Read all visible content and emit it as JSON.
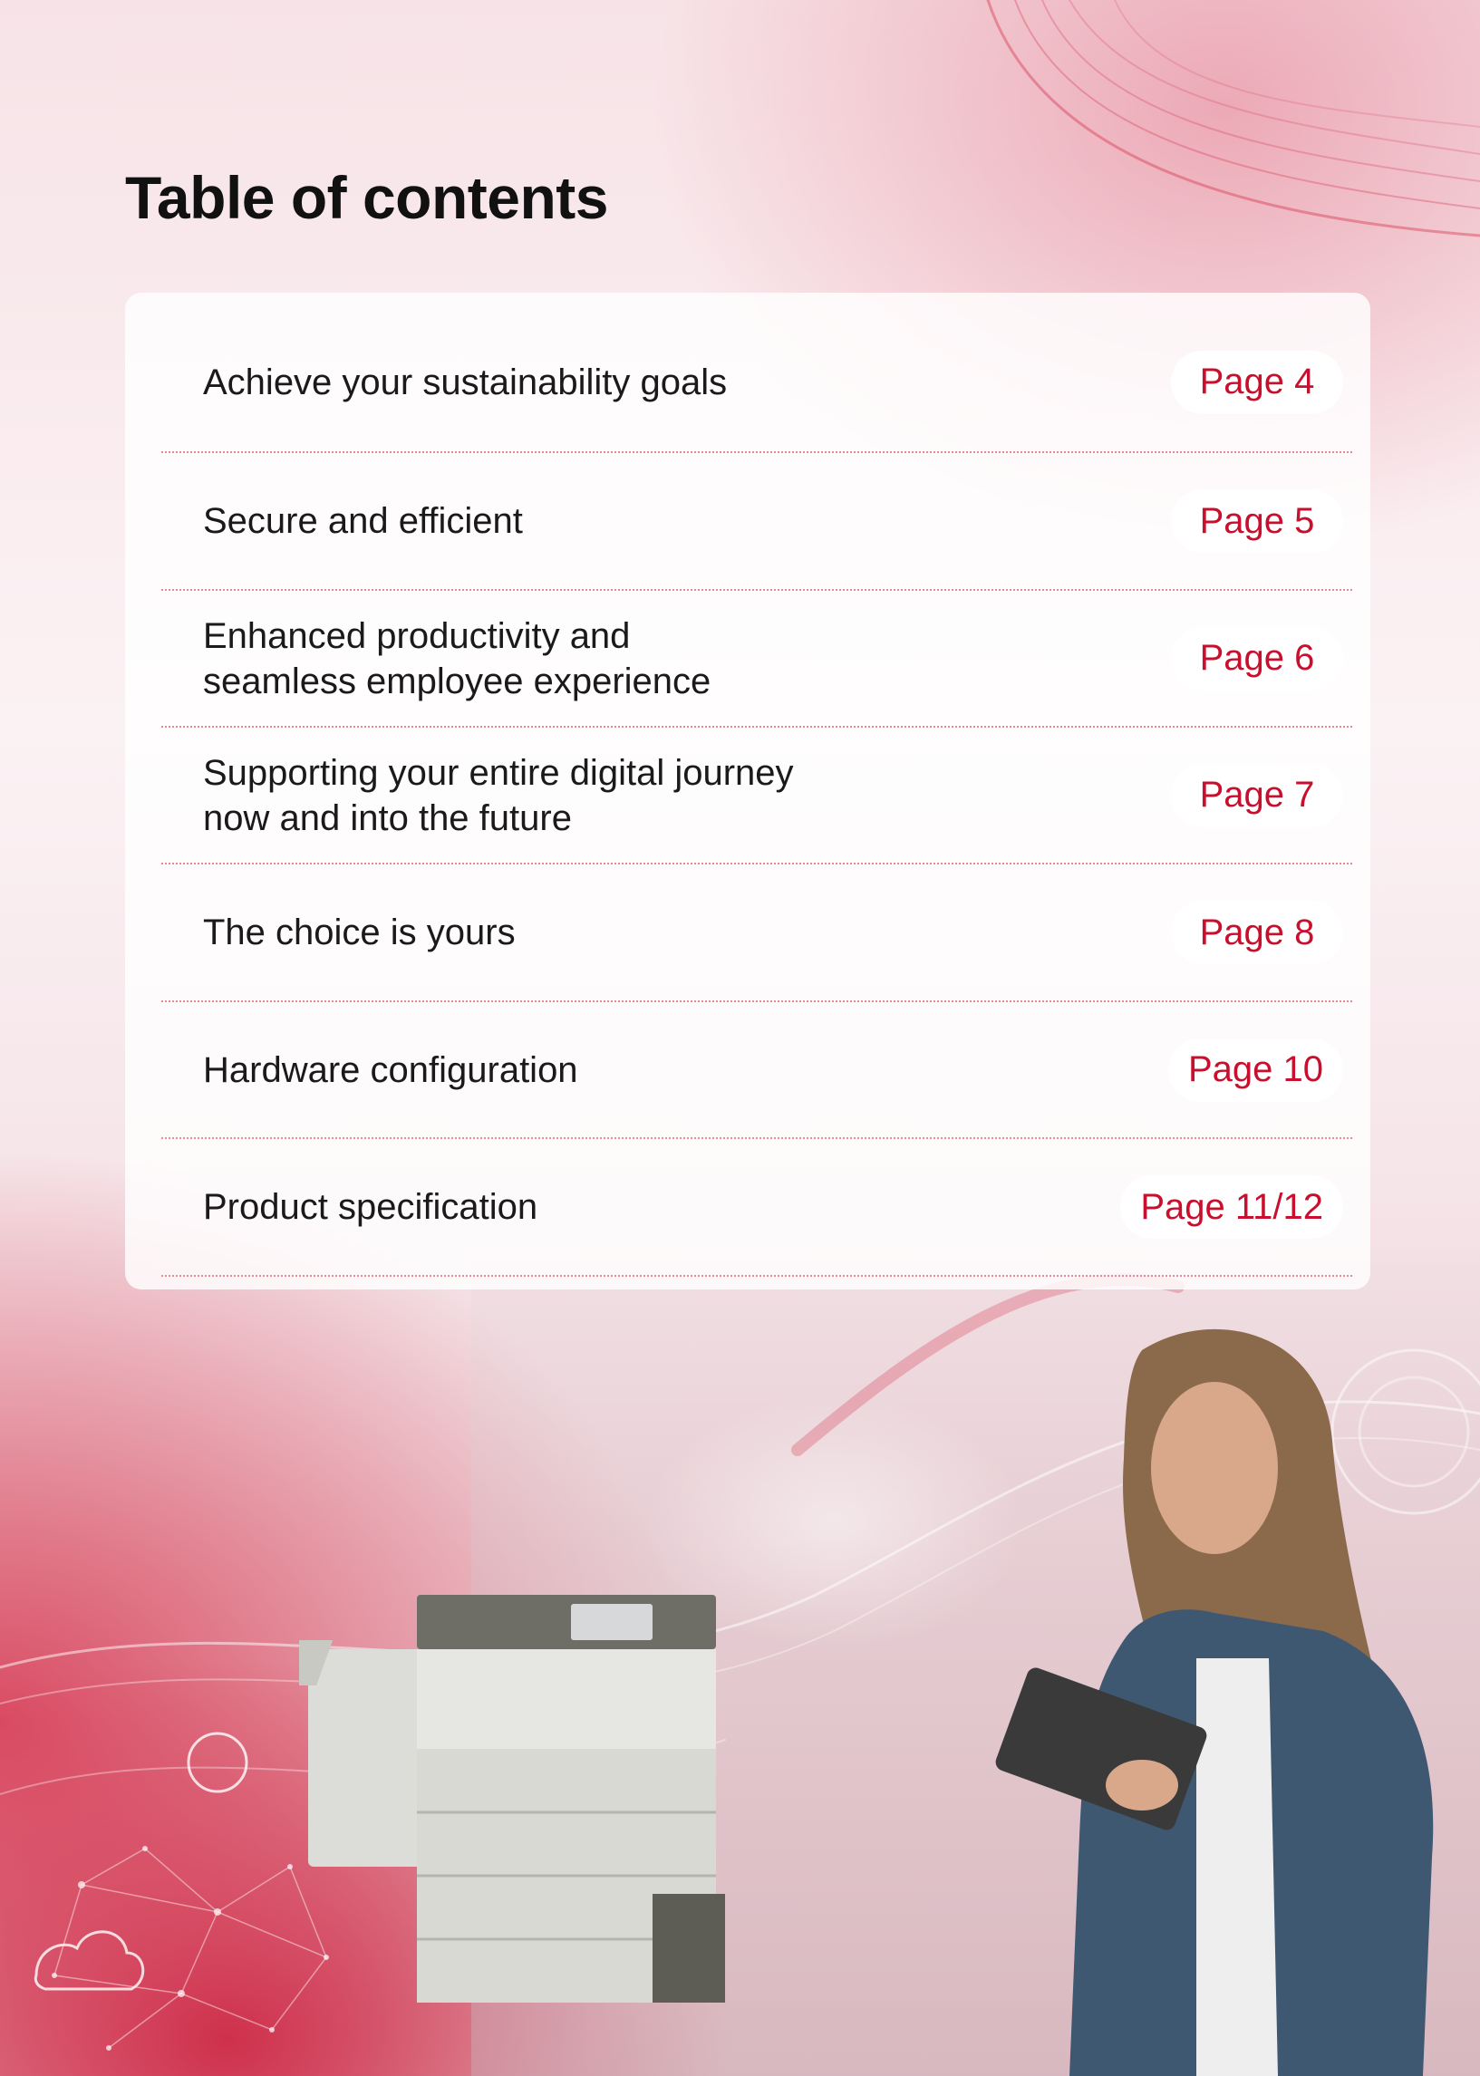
{
  "page": {
    "title": "Table of contents"
  },
  "toc": {
    "items": [
      {
        "label": "Achieve your sustainability goals",
        "page": "Page 4"
      },
      {
        "label": "Secure and efficient",
        "page": "Page 5"
      },
      {
        "label": "Enhanced productivity and\nseamless employee experience",
        "page": "Page 6"
      },
      {
        "label": "Supporting your entire digital journey\nnow and into the future",
        "page": "Page 7"
      },
      {
        "label": "The choice is yours",
        "page": "Page 8"
      },
      {
        "label": "Hardware configuration",
        "page": "Page 10"
      },
      {
        "label": "Product specification",
        "page": "Page 11/12"
      }
    ]
  },
  "colors": {
    "accent": "#c8102e",
    "title": "#111111",
    "divider": "#e38a98"
  },
  "images": {
    "illustration": "office-printer-and-woman-with-tablet"
  }
}
